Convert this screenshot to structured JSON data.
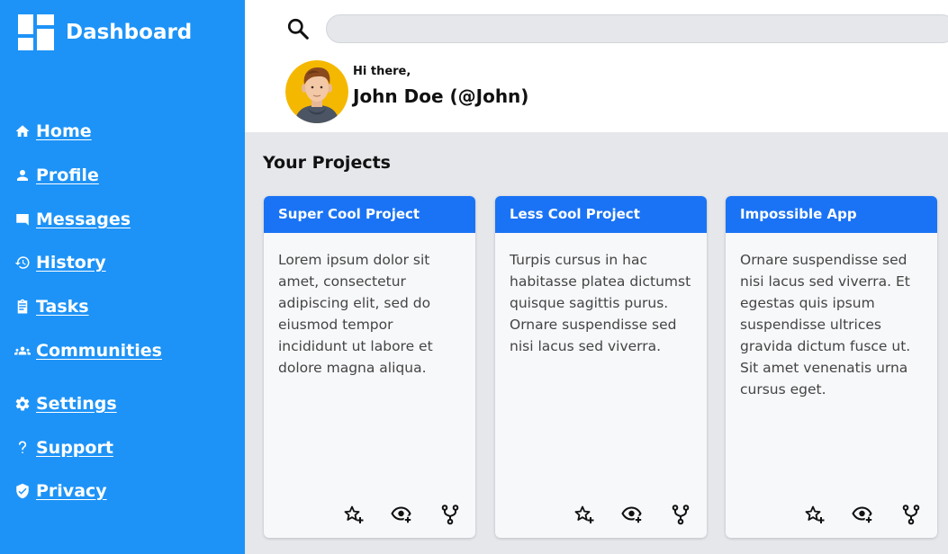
{
  "app": {
    "title": "Dashboard"
  },
  "nav": {
    "items": [
      {
        "label": "Home",
        "icon": "home-icon"
      },
      {
        "label": "Profile",
        "icon": "person-icon"
      },
      {
        "label": "Messages",
        "icon": "message-icon"
      },
      {
        "label": "History",
        "icon": "history-icon"
      },
      {
        "label": "Tasks",
        "icon": "clipboard-icon"
      },
      {
        "label": "Communities",
        "icon": "group-icon"
      },
      {
        "label": "Settings",
        "icon": "gear-icon"
      },
      {
        "label": "Support",
        "icon": "question-icon"
      },
      {
        "label": "Privacy",
        "icon": "shield-icon"
      }
    ]
  },
  "header": {
    "search": {
      "value": "",
      "placeholder": ""
    },
    "greeting": "Hi there,",
    "user_name": "John Doe (@John)"
  },
  "main": {
    "section_title": "Your Projects",
    "projects": [
      {
        "title": "Super Cool Project",
        "description": "Lorem ipsum dolor sit amet, consectetur adipiscing elit, sed do eiusmod tempor incididunt ut labore et dolore magna aliqua."
      },
      {
        "title": "Less Cool Project",
        "description": "Turpis cursus in hac habitasse platea dictumst quisque sagittis purus. Ornare suspendisse sed nisi lacus sed viverra."
      },
      {
        "title": "Impossible App",
        "description": "Ornare suspendisse sed nisi lacus sed viverra. Et egestas quis ipsum suspendisse ultrices gravida dictum fusce ut. Sit amet venenatis urna cursus eget."
      }
    ],
    "card_actions": [
      "star-add-icon",
      "watch-icon",
      "fork-icon"
    ]
  },
  "colors": {
    "sidebar": "#1d93f7",
    "card_header": "#1a73f5",
    "content_bg": "#e5e7eb",
    "avatar_bg": "#f5b800"
  }
}
